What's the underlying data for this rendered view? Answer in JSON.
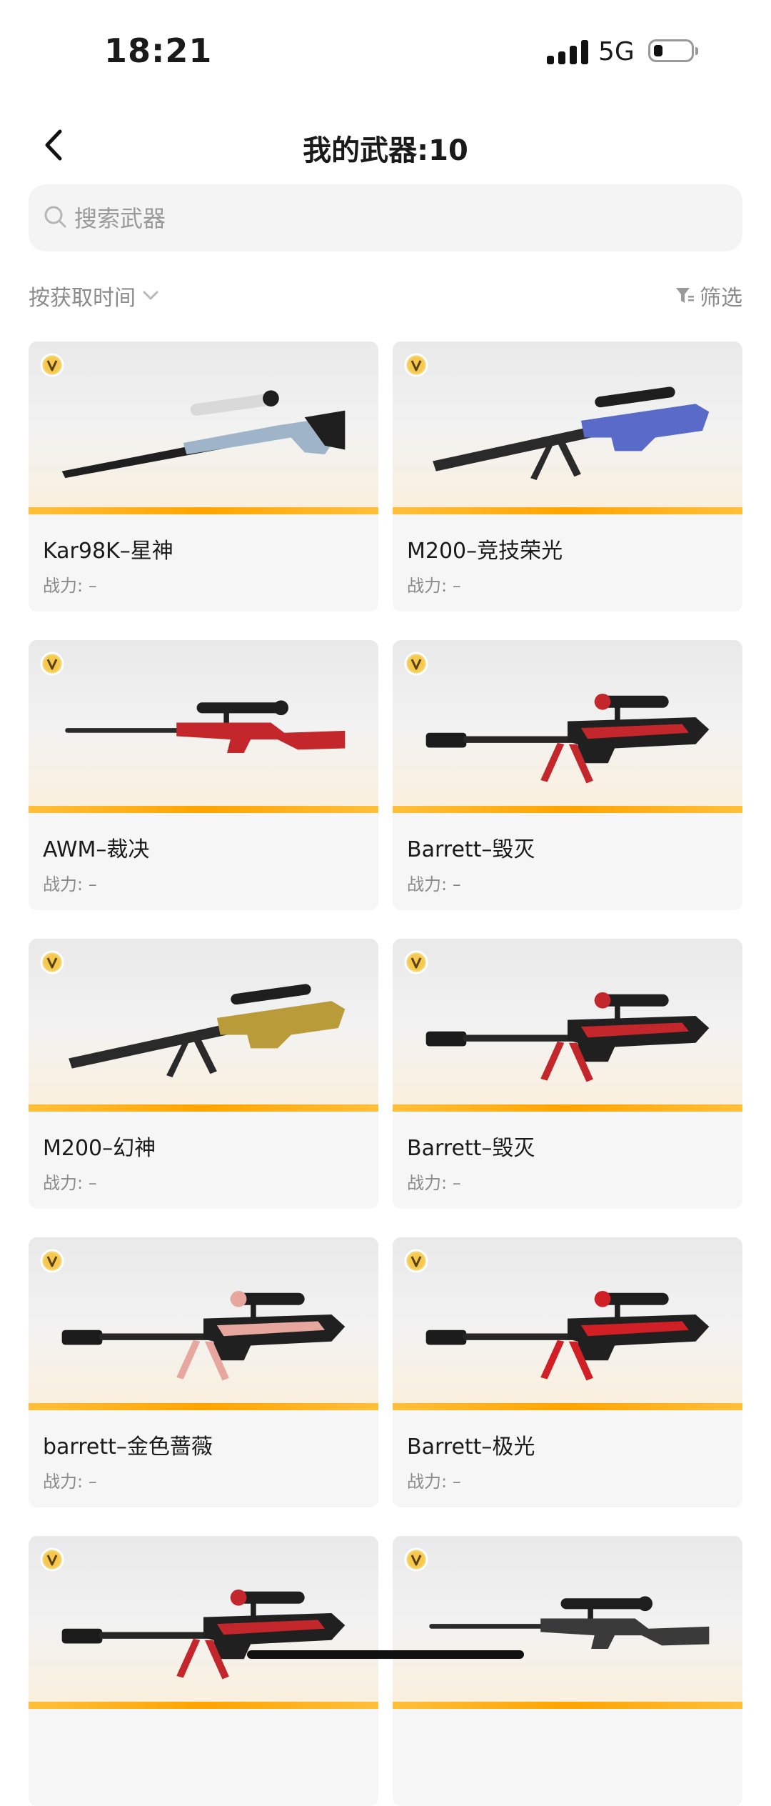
{
  "status_bar": {
    "time": "18:21",
    "network": "5G"
  },
  "header": {
    "title": "我的武器:10"
  },
  "search": {
    "placeholder": "搜索武器",
    "value": ""
  },
  "sort": {
    "label": "按获取时间"
  },
  "filter": {
    "label": "筛选"
  },
  "weapon_card": {
    "power_label": "战力:",
    "power_value": "–"
  },
  "weapons": [
    {
      "name": "Kar98K–星神",
      "accent": "#9fb4c8",
      "icon": "kar98k-rifle"
    },
    {
      "name": "M200–竞技荣光",
      "accent": "#5a6ac8",
      "icon": "m200-sniper-rifle"
    },
    {
      "name": "AWM–裁决",
      "accent": "#c3262b",
      "icon": "awm-sniper-rifle"
    },
    {
      "name": "Barrett–毁灭",
      "accent": "#c3262b",
      "icon": "barrett-rifle"
    },
    {
      "name": "M200–幻神",
      "accent": "#b99b3a",
      "icon": "m200-sniper-rifle"
    },
    {
      "name": "Barrett–毁灭",
      "accent": "#c3262b",
      "icon": "barrett-rifle"
    },
    {
      "name": "barrett–金色蔷薇",
      "accent": "#e7a79e",
      "icon": "barrett-rifle"
    },
    {
      "name": "Barrett–极光",
      "accent": "#d11f26",
      "icon": "barrett-rifle"
    },
    {
      "name": "",
      "accent": "#c3262b",
      "icon": "barrett-rifle"
    },
    {
      "name": "",
      "accent": "#3a3a3a",
      "icon": "awm-sniper-rifle"
    }
  ],
  "colors": {
    "accent_bar": "#ffa400",
    "card_bg": "#f6f6f6",
    "search_bg": "#f4f4f5"
  }
}
